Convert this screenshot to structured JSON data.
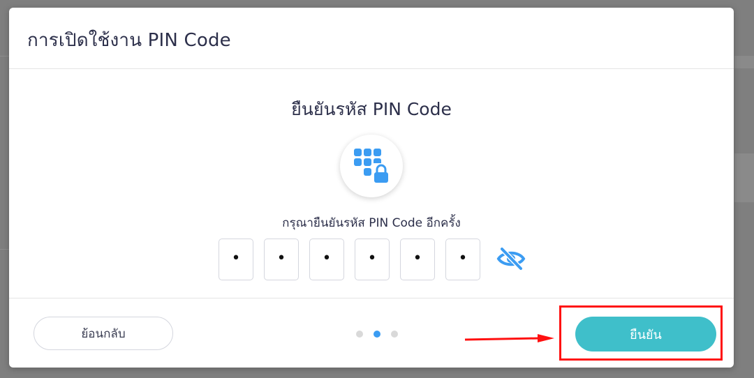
{
  "modal": {
    "title": "การเปิดใช้งาน PIN Code",
    "subtitle": "ยืนยันรหัส PIN Code",
    "keypad_icon": "keypad-lock-icon",
    "instruction": "กรุณายืนยันรหัส PIN Code อีกครั้ง",
    "pin_digits": [
      "•",
      "•",
      "•",
      "•",
      "•",
      "•"
    ],
    "active_pin_index": 5,
    "eye_icon": "eye-slash-icon"
  },
  "footer": {
    "back_label": "ย้อนกลับ",
    "confirm_label": "ยืนยัน",
    "step_total": 3,
    "step_current": 2
  },
  "annotation": {
    "arrow_icon": "red-arrow-icon",
    "highlight_color": "#ff1010"
  },
  "colors": {
    "accent_blue": "#3b9cf2",
    "confirm_teal": "#3fbfca",
    "text_dark": "#2c2f4a"
  }
}
